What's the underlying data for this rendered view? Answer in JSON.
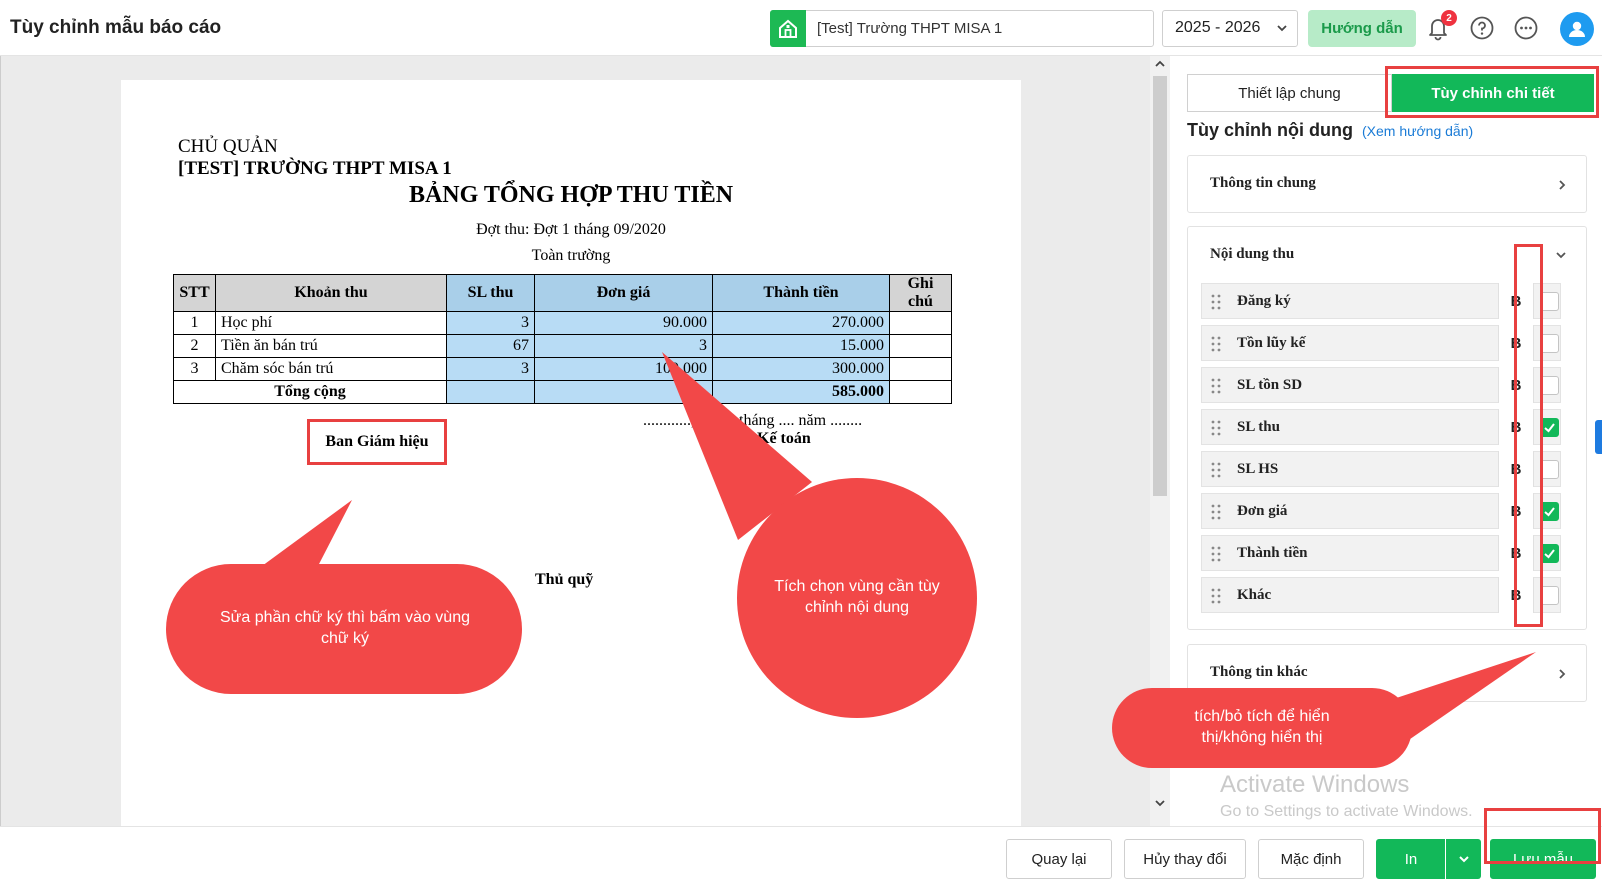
{
  "topbar": {
    "title": "Tùy chỉnh mẫu báo cáo",
    "school": "[Test] Trường THPT MISA 1",
    "school_icon": "school-building-icon",
    "year": "2025 - 2026",
    "guide_label": "Hướng dẫn",
    "notification_count": "2",
    "icons": [
      "bell-icon",
      "help-icon",
      "more-icon",
      "user-avatar-icon"
    ]
  },
  "report": {
    "owner_label": "CHỦ QUẢN",
    "school_name": "[TEST] TRƯỜNG THPT MISA 1",
    "title": "BẢNG TỔNG HỢP THU TIỀN",
    "period": "Đợt thu: Đợt 1 tháng 09/2020",
    "scope": "Toàn trường",
    "columns": [
      "STT",
      "Khoản thu",
      "SL thu",
      "Đơn giá",
      "Thành tiền",
      "Ghi chú"
    ],
    "rows": [
      {
        "stt": "1",
        "item": "Học phí",
        "qty": "3",
        "price": "90.000",
        "amount": "270.000",
        "note": ""
      },
      {
        "stt": "2",
        "item": "Tiền ăn bán trú",
        "qty": "67",
        "price": "3",
        "amount": "15.000",
        "note": ""
      },
      {
        "stt": "3",
        "item": "Chăm sóc bán trú",
        "qty": "3",
        "price": "100.000",
        "amount": "300.000",
        "note": ""
      }
    ],
    "total_label": "Tổng cộng",
    "total_amount": "585.000",
    "date_line": "............, ......... tháng .... năm ........",
    "signature_board": "Ban Giám hiệu",
    "signature_accountant": "Kế toán",
    "signature_treasurer": "Thủ quỹ"
  },
  "panel": {
    "tab_general": "Thiết lập chung",
    "tab_detail": "Tùy chỉnh chi tiết",
    "heading": "Tùy chỉnh nội dung",
    "heading_link": "(Xem hướng dẫn)",
    "section_general": "Thông tin chung",
    "section_content": "Nội dung thu",
    "bold_label": "B",
    "fields": [
      {
        "label": "Đăng ký",
        "checked": false
      },
      {
        "label": "Tồn lũy kế",
        "checked": false
      },
      {
        "label": "SL tồn SD",
        "checked": false
      },
      {
        "label": "SL thu",
        "checked": true
      },
      {
        "label": "SL HS",
        "checked": false
      },
      {
        "label": "Đơn giá",
        "checked": true
      },
      {
        "label": "Thành tiền",
        "checked": true
      },
      {
        "label": "Khác",
        "checked": false
      }
    ],
    "section_other": "Thông tin khác"
  },
  "callouts": {
    "signature": "Sửa phần chữ ký thì bấm vào vùng chữ ký",
    "select_region": "Tích chọn vùng cần tùy chỉnh nội dung",
    "toggle": "tích/bỏ tích để hiển thị/không hiển thị"
  },
  "watermark": {
    "line1": "Activate Windows",
    "line2": "Go to Settings to activate Windows."
  },
  "footer": {
    "back": "Quay lại",
    "cancel": "Hủy thay đổi",
    "default": "Mặc định",
    "print": "In",
    "save": "Lưu mẫu"
  },
  "colors": {
    "accent_green": "#12b859",
    "highlight_red": "#e84040",
    "callout_red": "#f24848",
    "selected_column": "#b8dcf5"
  }
}
